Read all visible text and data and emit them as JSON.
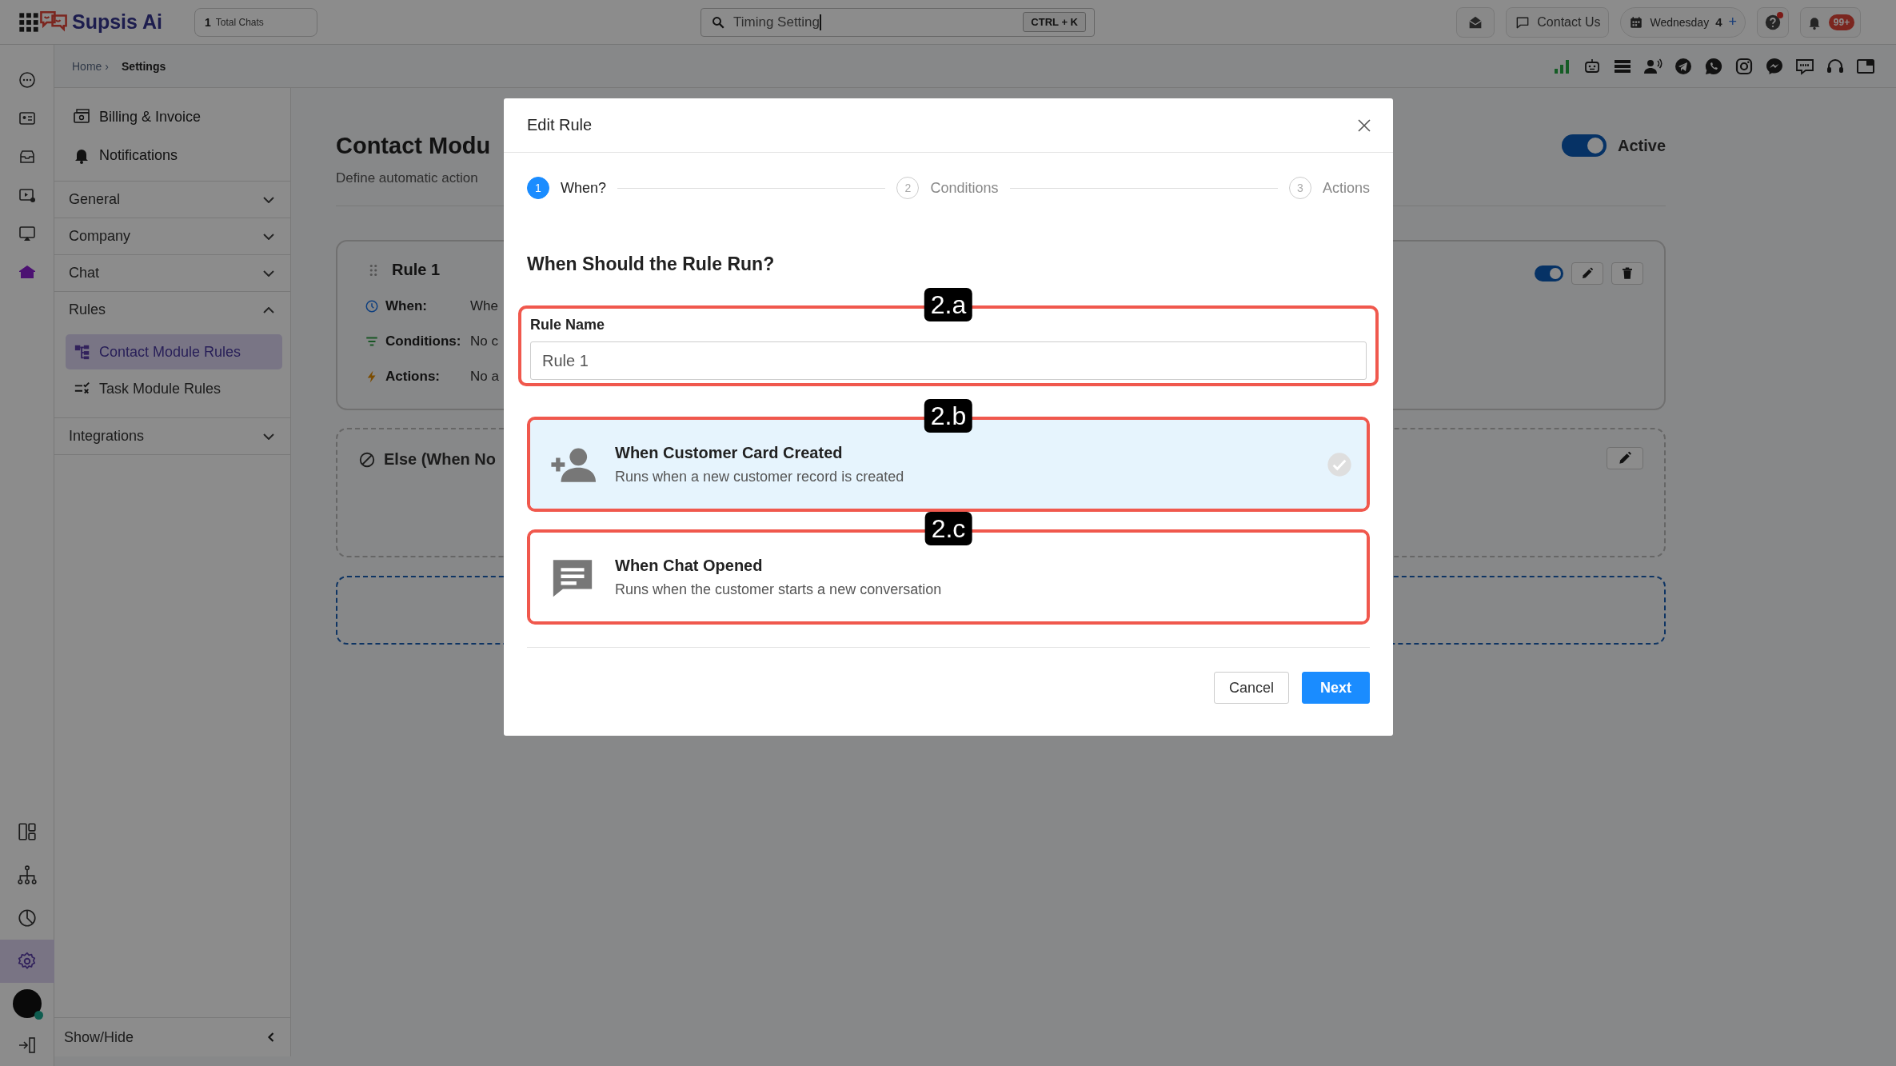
{
  "top_bar": {
    "brand": "Supsis Ai",
    "chat_count": "1",
    "chat_label": "Total Chats",
    "search": {
      "value": "Timing Setting"
    },
    "shortcut": "CTRL + K",
    "contact_button": "Contact Us",
    "date": {
      "day": "Wednesday",
      "number": "4",
      "add": "+"
    },
    "notification_badge": "99+"
  },
  "rail": {
    "top": [
      {
        "selected": false
      },
      {
        "selected": false
      },
      {
        "selected": false
      },
      {
        "selected": false
      },
      {
        "selected": false
      },
      {
        "selected": true
      }
    ],
    "bottom": [
      {
        "selected": false
      },
      {
        "selected": false
      },
      {
        "selected": false
      },
      {
        "selected": true
      }
    ]
  },
  "breadcrumb": {
    "separator": "›",
    "items": [
      {
        "label": "Home",
        "selected": false
      },
      {
        "label": "Settings",
        "selected": true
      }
    ]
  },
  "settings_nav": {
    "links": [
      "Billing & Invoice",
      "Notifications"
    ],
    "sections": [
      {
        "label": "General",
        "expanded": false
      },
      {
        "label": "Company",
        "expanded": false
      },
      {
        "label": "Chat",
        "expanded": false
      },
      {
        "label": "Rules",
        "expanded": true,
        "children": [
          {
            "label": "Contact Module Rules",
            "selected": true
          },
          {
            "label": "Task Module Rules",
            "selected": false
          }
        ]
      },
      {
        "label": "Integrations",
        "expanded": false
      }
    ],
    "footer": "Show/Hide"
  },
  "page": {
    "title": "Contact Modu",
    "subtitle": "Define automatic action",
    "status": {
      "label": "Active",
      "on": true
    },
    "rules": [
      {
        "title": "Rule 1",
        "on": true,
        "rows": [
          {
            "label": "When:",
            "value": "Whe"
          },
          {
            "label": "Conditions:",
            "value": "No c"
          },
          {
            "label": "Actions:",
            "value": "No a"
          }
        ]
      }
    ],
    "else_title": "Else (When No"
  },
  "modal": {
    "title": "Edit Rule",
    "steps": [
      {
        "number": "1",
        "label": "When?",
        "selected": true
      },
      {
        "number": "2",
        "label": "Conditions",
        "selected": false
      },
      {
        "number": "3",
        "label": "Actions",
        "selected": false
      }
    ],
    "heading": "When Should the Rule Run?",
    "field": {
      "label": "Rule Name",
      "value": "Rule 1"
    },
    "triggers": [
      {
        "title": "When Customer Card Created",
        "description": "Runs when a new customer record is created",
        "selected": true
      },
      {
        "title": "When Chat Opened",
        "description": "Runs when the customer starts a new conversation",
        "selected": false
      }
    ],
    "callouts": [
      "2.a",
      "2.b",
      "2.c"
    ],
    "buttons": {
      "cancel": "Cancel",
      "next": "Next"
    }
  }
}
